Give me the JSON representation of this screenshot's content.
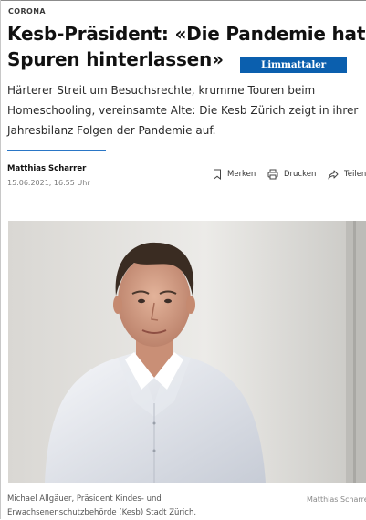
{
  "article": {
    "kicker": "CORONA",
    "headline": "Kesb-Präsident: «Die Pandemie hat Spuren hinterlassen»",
    "publication_logo": "Limmattaler Zeitung",
    "lead": "Härterer Streit um Besuchsrechte, krumme Touren beim Homeschooling, vereinsamte Alte: Die Kesb Zürich zeigt in ihrer Jahresbilanz Folgen der Pandemie auf.",
    "author": "Matthias Scharrer",
    "date": "15.06.2021, 16.55 Uhr"
  },
  "actions": {
    "bookmark_label": "Merken",
    "bookmark_icon": "bookmark-icon",
    "print_label": "Drucken",
    "print_icon": "printer-icon",
    "share_label": "Teilen",
    "share_icon": "share-arrow-icon"
  },
  "image": {
    "caption": "Michael Allgäuer, Präsident Kindes- und Erwachsenenschutzbehörde (Kesb) Stadt Zürich.",
    "credit": "Matthias Scharrer"
  },
  "colors": {
    "logo_background": "#0b5fae",
    "accent_line": "#2a76c6",
    "text": "#1a1a1a"
  }
}
